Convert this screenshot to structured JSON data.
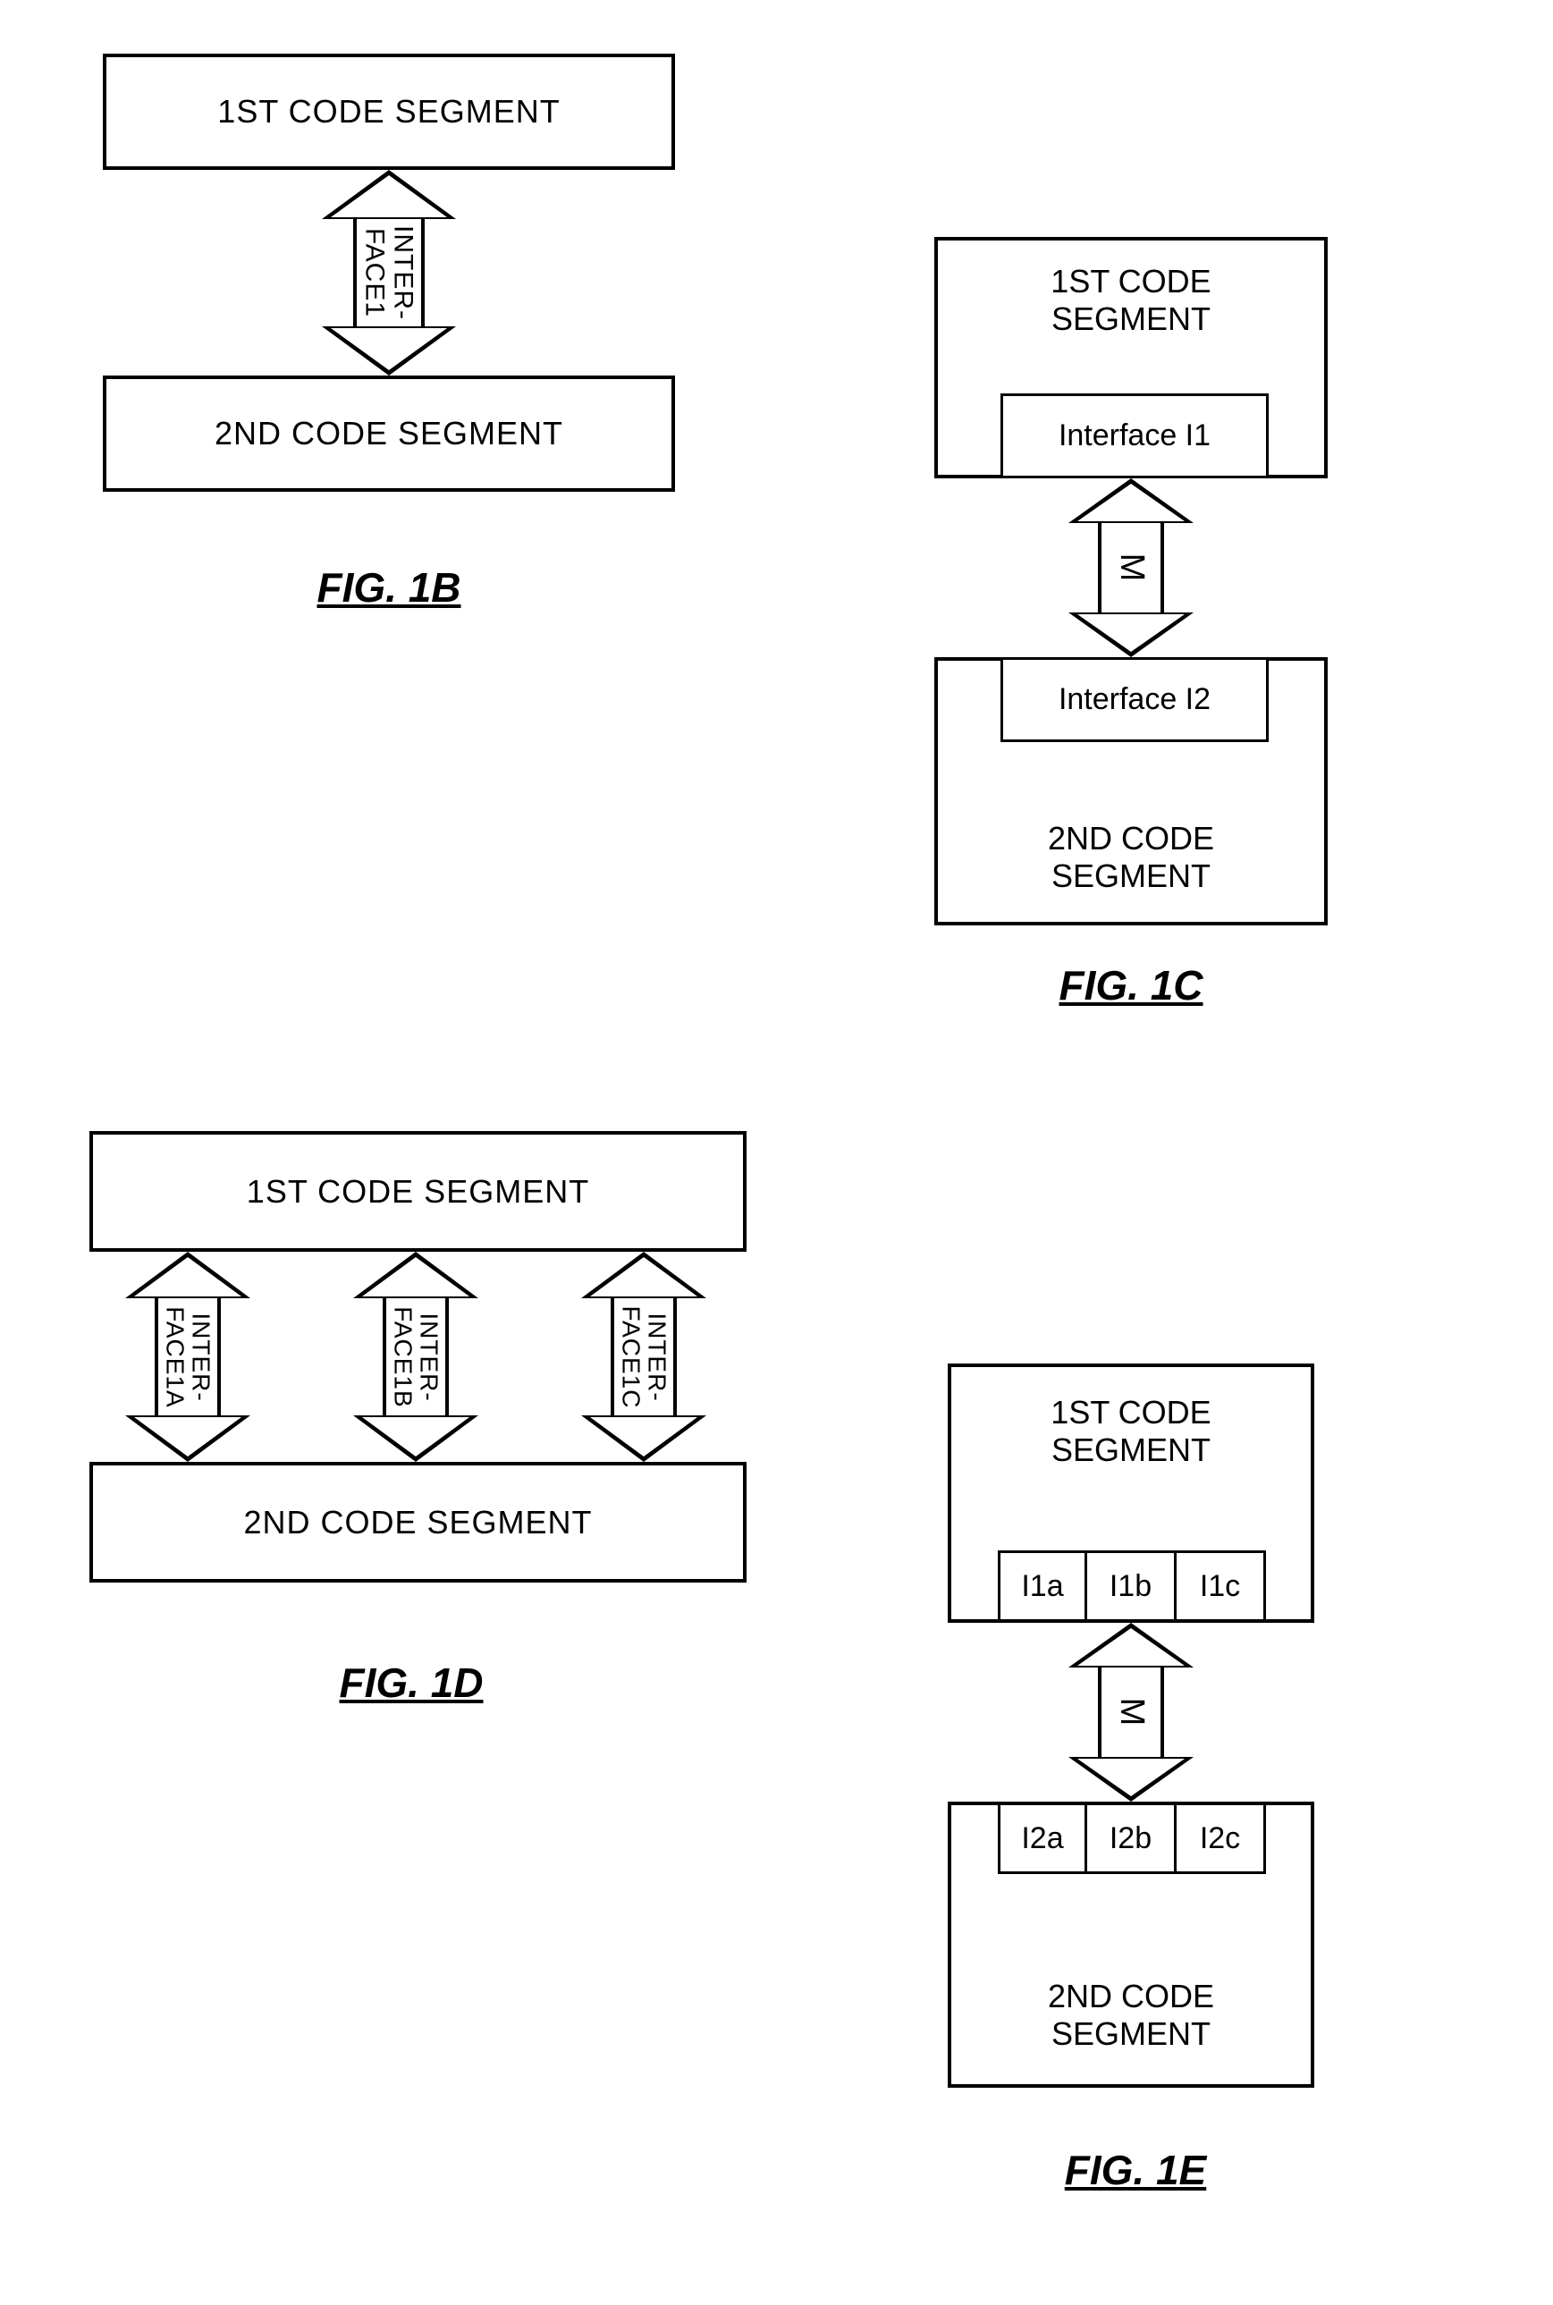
{
  "fig1B": {
    "top_box": "1ST CODE SEGMENT",
    "bottom_box": "2ND CODE SEGMENT",
    "arrow_label": "INTER-\nFACE1",
    "caption": "FIG. 1B"
  },
  "fig1C": {
    "top_box": "1ST CODE\nSEGMENT",
    "top_iface": "Interface I1",
    "arrow_label": "M",
    "bottom_iface": "Interface I2",
    "bottom_box": "2ND CODE\nSEGMENT",
    "caption": "FIG. 1C"
  },
  "fig1D": {
    "top_box": "1ST CODE SEGMENT",
    "bottom_box": "2ND CODE SEGMENT",
    "arrow_labels": [
      "INTER-\nFACE1A",
      "INTER-\nFACE1B",
      "INTER-\nFACE1C"
    ],
    "caption": "FIG. 1D"
  },
  "fig1E": {
    "top_box": "1ST CODE\nSEGMENT",
    "top_ifaces": [
      "I1a",
      "I1b",
      "I1c"
    ],
    "arrow_label": "M",
    "bottom_ifaces": [
      "I2a",
      "I2b",
      "I2c"
    ],
    "bottom_box": "2ND CODE\nSEGMENT",
    "caption": "FIG. 1E"
  }
}
